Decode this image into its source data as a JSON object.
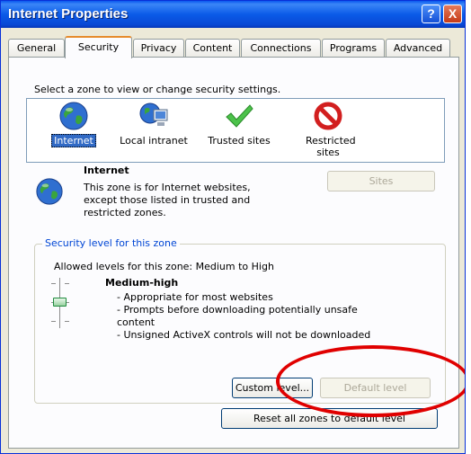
{
  "window": {
    "title": "Internet Properties",
    "help_label": "?",
    "close_label": "X"
  },
  "tabs": [
    {
      "label": "General"
    },
    {
      "label": "Security"
    },
    {
      "label": "Privacy"
    },
    {
      "label": "Content"
    },
    {
      "label": "Connections"
    },
    {
      "label": "Programs"
    },
    {
      "label": "Advanced"
    }
  ],
  "security": {
    "prompt": "Select a zone to view or change security settings.",
    "zones": [
      {
        "label": "Internet",
        "icon": "globe-icon"
      },
      {
        "label": "Local intranet",
        "icon": "intranet-icon"
      },
      {
        "label": "Trusted sites",
        "icon": "checkmark-icon"
      },
      {
        "label": "Restricted sites",
        "icon": "restricted-icon"
      }
    ],
    "selected_zone": {
      "name": "Internet",
      "description_lines": [
        "This zone is for Internet websites,",
        "except those listed in trusted and",
        "restricted zones."
      ],
      "sites_button": "Sites"
    },
    "level_group": {
      "title": "Security level for this zone",
      "allowed": "Allowed levels for this zone: Medium to High",
      "level_name": "Medium-high",
      "bullets": [
        "- Appropriate for most websites",
        "- Prompts before downloading potentially unsafe",
        "content",
        "- Unsigned ActiveX controls will not be downloaded"
      ],
      "custom_level_button": "Custom level...",
      "default_level_button": "Default level"
    },
    "reset_button": "Reset all zones to default level"
  },
  "colors": {
    "title_bar": "#0a58ee",
    "accent_tab": "#e68b2c",
    "group_title": "#0046d5",
    "annotation": "#e00000"
  }
}
